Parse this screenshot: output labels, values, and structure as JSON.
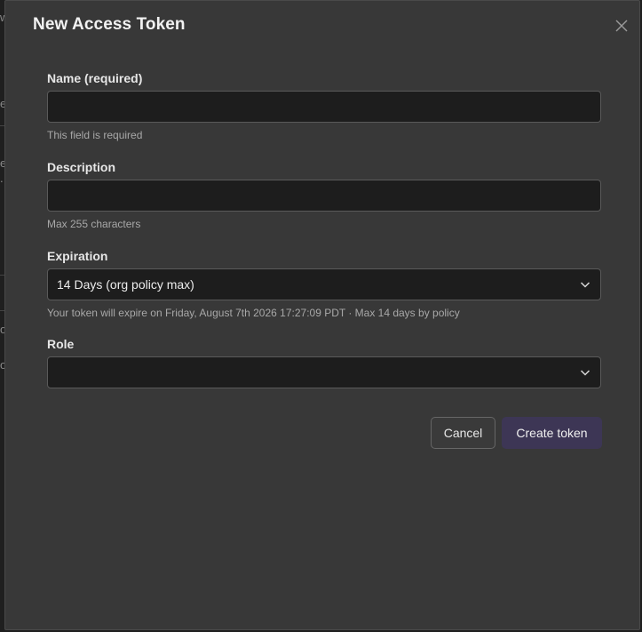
{
  "modal": {
    "title": "New Access Token",
    "close_icon": "close-icon"
  },
  "background": {
    "fragments": [
      "w",
      "e",
      "e",
      ".",
      "o",
      "o"
    ]
  },
  "form": {
    "name": {
      "label": "Name (required)",
      "value": "",
      "helper": "This field is required"
    },
    "description": {
      "label": "Description",
      "value": "",
      "helper": "Max 255 characters"
    },
    "expiration": {
      "label": "Expiration",
      "selected": "14 Days (org policy max)",
      "helper": "Your token will expire on Friday, August 7th 2026 17:27:09 PDT · Max 14 days by policy",
      "icon": "chevron-down-icon"
    },
    "role": {
      "label": "Role",
      "selected": "",
      "icon": "chevron-down-icon"
    }
  },
  "actions": {
    "cancel_label": "Cancel",
    "create_label": "Create token"
  },
  "colors": {
    "modal_bg": "#383838",
    "input_bg": "#1d1d1d",
    "primary_button": "#3d3655"
  }
}
